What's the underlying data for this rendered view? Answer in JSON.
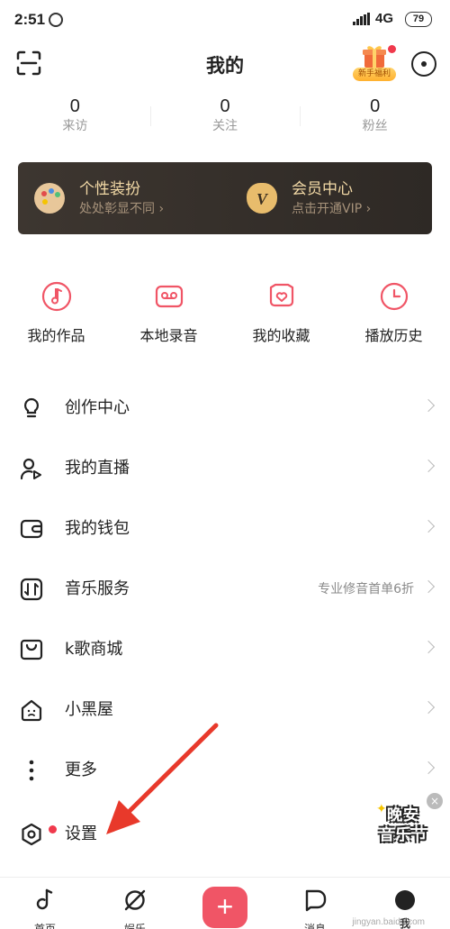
{
  "status_bar": {
    "time": "2:51",
    "network": "4G",
    "battery": "79"
  },
  "header": {
    "title": "我的",
    "gift_label": "新手福利"
  },
  "stats": [
    {
      "value": "0",
      "label": "来访"
    },
    {
      "value": "0",
      "label": "关注"
    },
    {
      "value": "0",
      "label": "粉丝"
    }
  ],
  "banner": {
    "left": {
      "title": "个性装扮",
      "subtitle": "处处彰显不同 ›"
    },
    "right": {
      "title": "会员中心",
      "subtitle": "点击开通VIP ›",
      "icon_text": "V"
    }
  },
  "quick_actions": [
    {
      "label": "我的作品",
      "icon": "music-note-icon"
    },
    {
      "label": "本地录音",
      "icon": "cassette-icon"
    },
    {
      "label": "我的收藏",
      "icon": "heart-icon"
    },
    {
      "label": "播放历史",
      "icon": "clock-icon"
    }
  ],
  "menu": [
    {
      "label": "创作中心",
      "icon": "lightbulb-icon",
      "right": ""
    },
    {
      "label": "我的直播",
      "icon": "live-user-icon",
      "right": ""
    },
    {
      "label": "我的钱包",
      "icon": "wallet-icon",
      "right": ""
    },
    {
      "label": "音乐服务",
      "icon": "music-service-icon",
      "right": "专业修音首单6折"
    },
    {
      "label": "k歌商城",
      "icon": "shopping-bag-icon",
      "right": ""
    },
    {
      "label": "小黑屋",
      "icon": "house-icon",
      "right": ""
    },
    {
      "label": "更多",
      "icon": "more-dots-icon",
      "right": ""
    },
    {
      "label": "设置",
      "icon": "settings-icon",
      "right": ""
    }
  ],
  "floating_widget": {
    "line1": "晚安",
    "line2": "音乐节",
    "close": "×"
  },
  "tabbar": [
    {
      "label": "首页",
      "icon": "home-note-icon"
    },
    {
      "label": "娱乐",
      "icon": "planet-icon"
    },
    {
      "label": "+",
      "icon": "plus-icon"
    },
    {
      "label": "消息",
      "icon": "message-icon"
    },
    {
      "label": "我",
      "icon": "avatar-icon"
    }
  ],
  "watermark": "jingyan.baidu.com",
  "colors": {
    "accent": "#f05566",
    "banner_bg": "#3a332d",
    "banner_gold": "#f2d9a6",
    "annotation_arrow": "#e8392b"
  }
}
